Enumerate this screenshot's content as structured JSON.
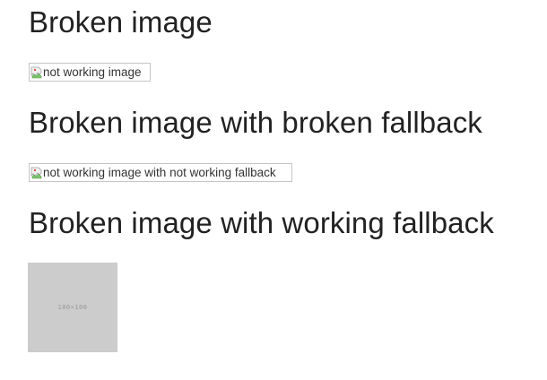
{
  "sections": [
    {
      "heading": "Broken image",
      "image_alt": "not working image"
    },
    {
      "heading": "Broken image with broken fallback",
      "image_alt": "not working image with not working fallback"
    },
    {
      "heading": "Broken image with working fallback",
      "placeholder_text": "100×100"
    }
  ],
  "colors": {
    "placeholder_bg": "#cccccc",
    "placeholder_text": "#969696",
    "heading_text": "#222222"
  },
  "icons": {
    "broken_image": "broken-image-icon"
  }
}
